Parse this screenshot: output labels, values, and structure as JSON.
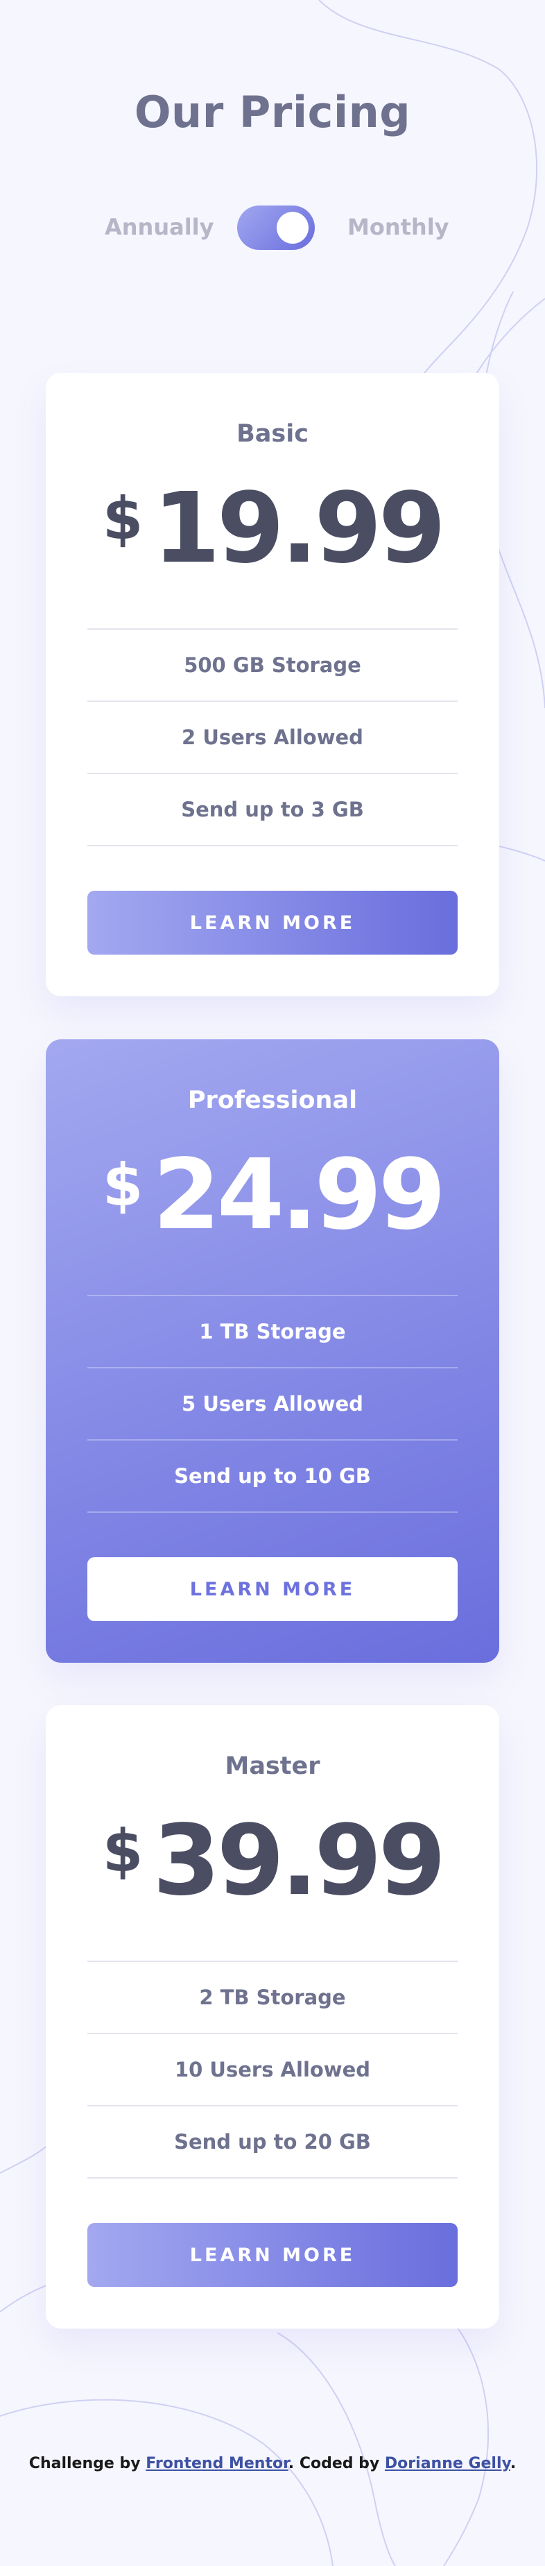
{
  "colors": {
    "background": "#f6f6fe",
    "accent_gradient_start": "#a3a8f0",
    "accent_gradient_end": "#696edd",
    "heading_text": "#6e728e",
    "price_text": "#4b4d63",
    "toggle_label_text": "#b6b6c8",
    "link": "#3e52a3"
  },
  "header": {
    "title": "Our Pricing"
  },
  "billing_toggle": {
    "annually_label": "Annually",
    "monthly_label": "Monthly",
    "selected": "Monthly"
  },
  "plans": [
    {
      "name": "Basic",
      "currency": "$",
      "price": "19.99",
      "features": [
        "500 GB Storage",
        "2 Users Allowed",
        "Send up to 3 GB"
      ],
      "button_label": "LEARN MORE"
    },
    {
      "name": "Professional",
      "currency": "$",
      "price": "24.99",
      "features": [
        "1 TB Storage",
        "5 Users Allowed",
        "Send up to 10 GB"
      ],
      "button_label": "LEARN MORE"
    },
    {
      "name": "Master",
      "currency": "$",
      "price": "39.99",
      "features": [
        "2 TB Storage",
        "10 Users Allowed",
        "Send up to 20 GB"
      ],
      "button_label": "LEARN MORE"
    }
  ],
  "footer": {
    "challenge_prefix": "Challenge by",
    "challenge_link": "Frontend Mentor",
    "coded_prefix": ". Coded by",
    "author_link": "Dorianne Gelly",
    "suffix": "."
  }
}
